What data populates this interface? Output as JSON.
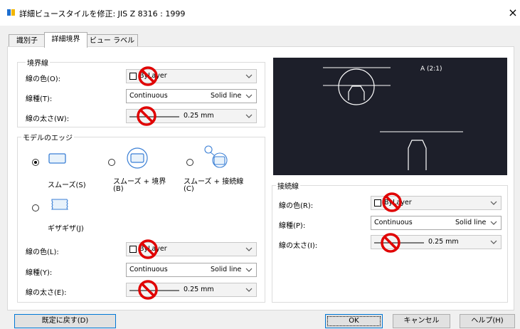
{
  "window": {
    "title": "詳細ビュースタイルを修正: JIS Z 8316 : 1999",
    "close": "×"
  },
  "tabs": [
    {
      "label": "識別子"
    },
    {
      "label": "詳細境界"
    },
    {
      "label": "ビュー ラベル"
    }
  ],
  "boundary": {
    "group_label": "境界線",
    "color_label": "線の色(O):",
    "color_value": "ByLayer",
    "linetype_label": "線種(T):",
    "linetype_value": "Continuous",
    "linetype_desc": "Solid line",
    "lineweight_label": "線の太さ(W):",
    "lineweight_value": "0.25 mm"
  },
  "model_edge": {
    "group_label": "モデルのエッジ",
    "smooth_label": "スムーズ(S)",
    "smooth_boundary_label": [
      "スムーズ + 境界",
      "(B)"
    ],
    "smooth_connection_label": [
      "スムーズ + 接続線",
      "(C)"
    ],
    "jagged_label": "ギザギザ(J)",
    "selected": "smooth",
    "color_label": "線の色(L):",
    "color_value": "ByLayer",
    "linetype_label": "線種(Y):",
    "linetype_value": "Continuous",
    "linetype_desc": "Solid line",
    "lineweight_label": "線の太さ(E):",
    "lineweight_value": "0.25 mm"
  },
  "preview": {
    "label": "A (2:1)"
  },
  "connection": {
    "group_label": "接続線",
    "color_label": "線の色(R):",
    "color_value": "ByLayer",
    "linetype_label": "線種(P):",
    "linetype_value": "Continuous",
    "linetype_desc": "Solid line",
    "lineweight_label": "線の太さ(I):",
    "lineweight_value": "0.25 mm"
  },
  "buttons": {
    "reset": "既定に戻す(D)",
    "ok": "OK",
    "cancel": "キャンセル",
    "help": "ヘルプ(H)"
  },
  "colors": {
    "preview_bg": "#1d1f2a",
    "no_entry": "#e00000",
    "accent": "#0078d7"
  },
  "icons": [
    "app-icon",
    "chevron-down-icon",
    "no-entry-icon",
    "smooth-edge-icon",
    "smooth-boundary-icon",
    "smooth-connection-icon",
    "jagged-edge-icon"
  ]
}
